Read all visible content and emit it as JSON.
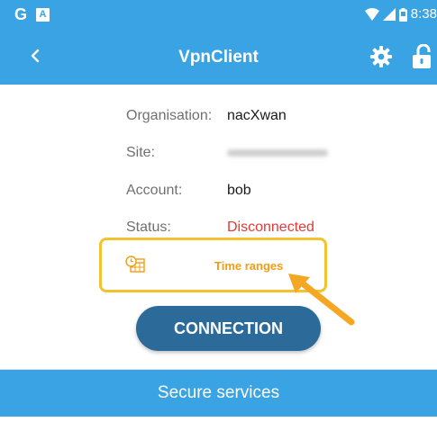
{
  "status_bar": {
    "carrier_icon": "G",
    "notification_icon": "A",
    "time": "8:38"
  },
  "app_bar": {
    "title": "VpnClient"
  },
  "info": {
    "organisation": {
      "label": "Organisation:",
      "value": "nacXwan"
    },
    "site": {
      "label": "Site:",
      "value": ""
    },
    "account": {
      "label": "Account:",
      "value": "bob"
    },
    "status": {
      "label": "Status:",
      "value": "Disconnected"
    }
  },
  "time_ranges": {
    "label": "Time ranges"
  },
  "connect_button": {
    "label": "CONNECTION"
  },
  "secure_services": {
    "label": "Secure services"
  },
  "colors": {
    "primary": "#3aa3e3",
    "button": "#2c6a9a",
    "status_error": "#e53935",
    "accent_orange": "#f39c12",
    "highlight_yellow": "#f2c230"
  }
}
